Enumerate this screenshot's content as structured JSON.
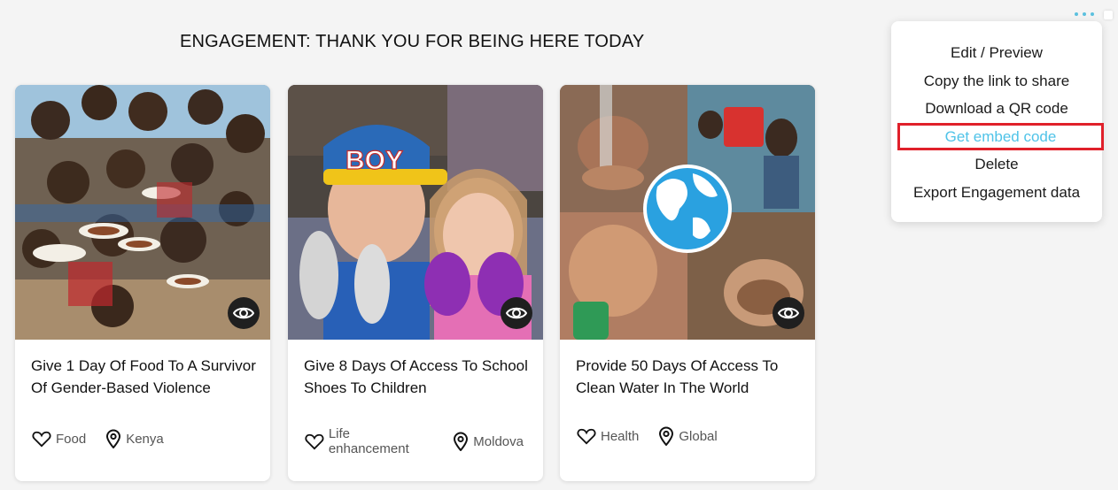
{
  "page": {
    "title": "ENGAGEMENT: THANK YOU FOR BEING HERE TODAY"
  },
  "cards": [
    {
      "title": "Give 1 Day Of Food To A Survivor Of Gender-Based Violence",
      "category": "Food",
      "location": "Kenya",
      "image_icon": "group-photo-icon"
    },
    {
      "title": "Give 8 Days Of Access To School Shoes To Children",
      "category": "Life enhancement",
      "location": "Moldova",
      "image_icon": "children-photo-icon"
    },
    {
      "title": "Provide 50 Days Of Access To Clean Water In The World",
      "category": "Health",
      "location": "Global",
      "image_icon": "water-collage-icon"
    }
  ],
  "menu": {
    "items": [
      "Edit / Preview",
      "Copy the link to share",
      "Download a QR code",
      "Get embed code",
      "Delete",
      "Export Engagement data"
    ],
    "highlighted_index": 3
  },
  "colors": {
    "accent": "#4fc3e8",
    "highlight_border": "#e0202a",
    "background": "#f4f4f4",
    "eye_button": "#1f1f1f"
  }
}
